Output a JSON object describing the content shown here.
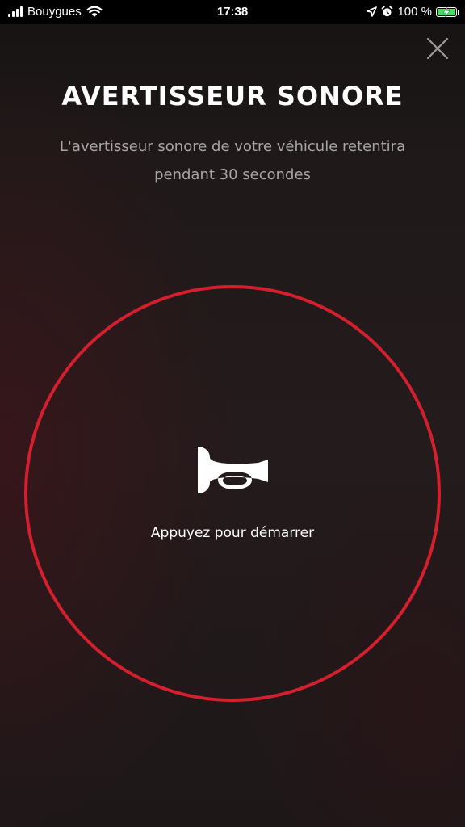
{
  "status_bar": {
    "carrier": "Bouygues",
    "time": "17:38",
    "battery_text": "100 %",
    "battery_level": 1.0,
    "signal_bars": 4,
    "icons": [
      "signal-icon",
      "wifi-icon",
      "location-arrow-icon",
      "alarm-icon",
      "battery-charging-icon"
    ]
  },
  "header": {
    "title": "AVERTISSEUR SONORE",
    "subtitle": "L'avertisseur sonore de votre véhicule retentira pendant 30 secondes",
    "close_icon": "close-icon"
  },
  "action": {
    "label": "Appuyez pour démarrer",
    "icon": "horn-icon"
  },
  "colors": {
    "accent": "#d31f2e",
    "background": "#201a1b",
    "text": "#ffffff",
    "muted_text": "#a9a5a5"
  }
}
